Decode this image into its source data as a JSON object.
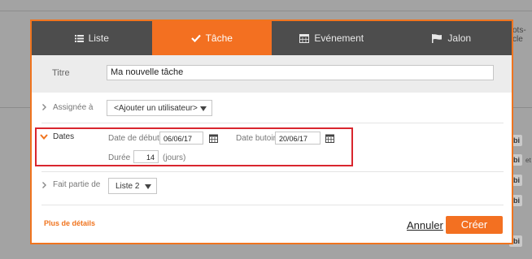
{
  "background": {
    "right_text": "ots-cle",
    "chip_label": "bi",
    "et_label": "et"
  },
  "tabs": [
    {
      "label": "Liste",
      "icon": "list-icon"
    },
    {
      "label": "Tâche",
      "icon": "check-icon",
      "active": true
    },
    {
      "label": "Evénement",
      "icon": "calendar-icon"
    },
    {
      "label": "Jalon",
      "icon": "flag-icon"
    }
  ],
  "form": {
    "title_label": "Titre",
    "title_value": "Ma nouvelle tâche",
    "assignee_label": "Assignée à",
    "assignee_value": "<Ajouter un utilisateur>",
    "dates_label": "Dates",
    "start_label": "Date de début",
    "start_value": "06/06/17",
    "due_label": "Date butoir",
    "due_value": "20/06/17",
    "duration_label": "Durée",
    "duration_value": "14",
    "duration_unit": "(jours)",
    "part_of_label": "Fait partie de",
    "part_of_value": "Liste 2"
  },
  "footer": {
    "more_details": "Plus de détails",
    "cancel": "Annuler",
    "create": "Créer"
  },
  "colors": {
    "accent": "#f37021",
    "tab_bar": "#4d4d4d",
    "highlight": "#d9262e"
  }
}
